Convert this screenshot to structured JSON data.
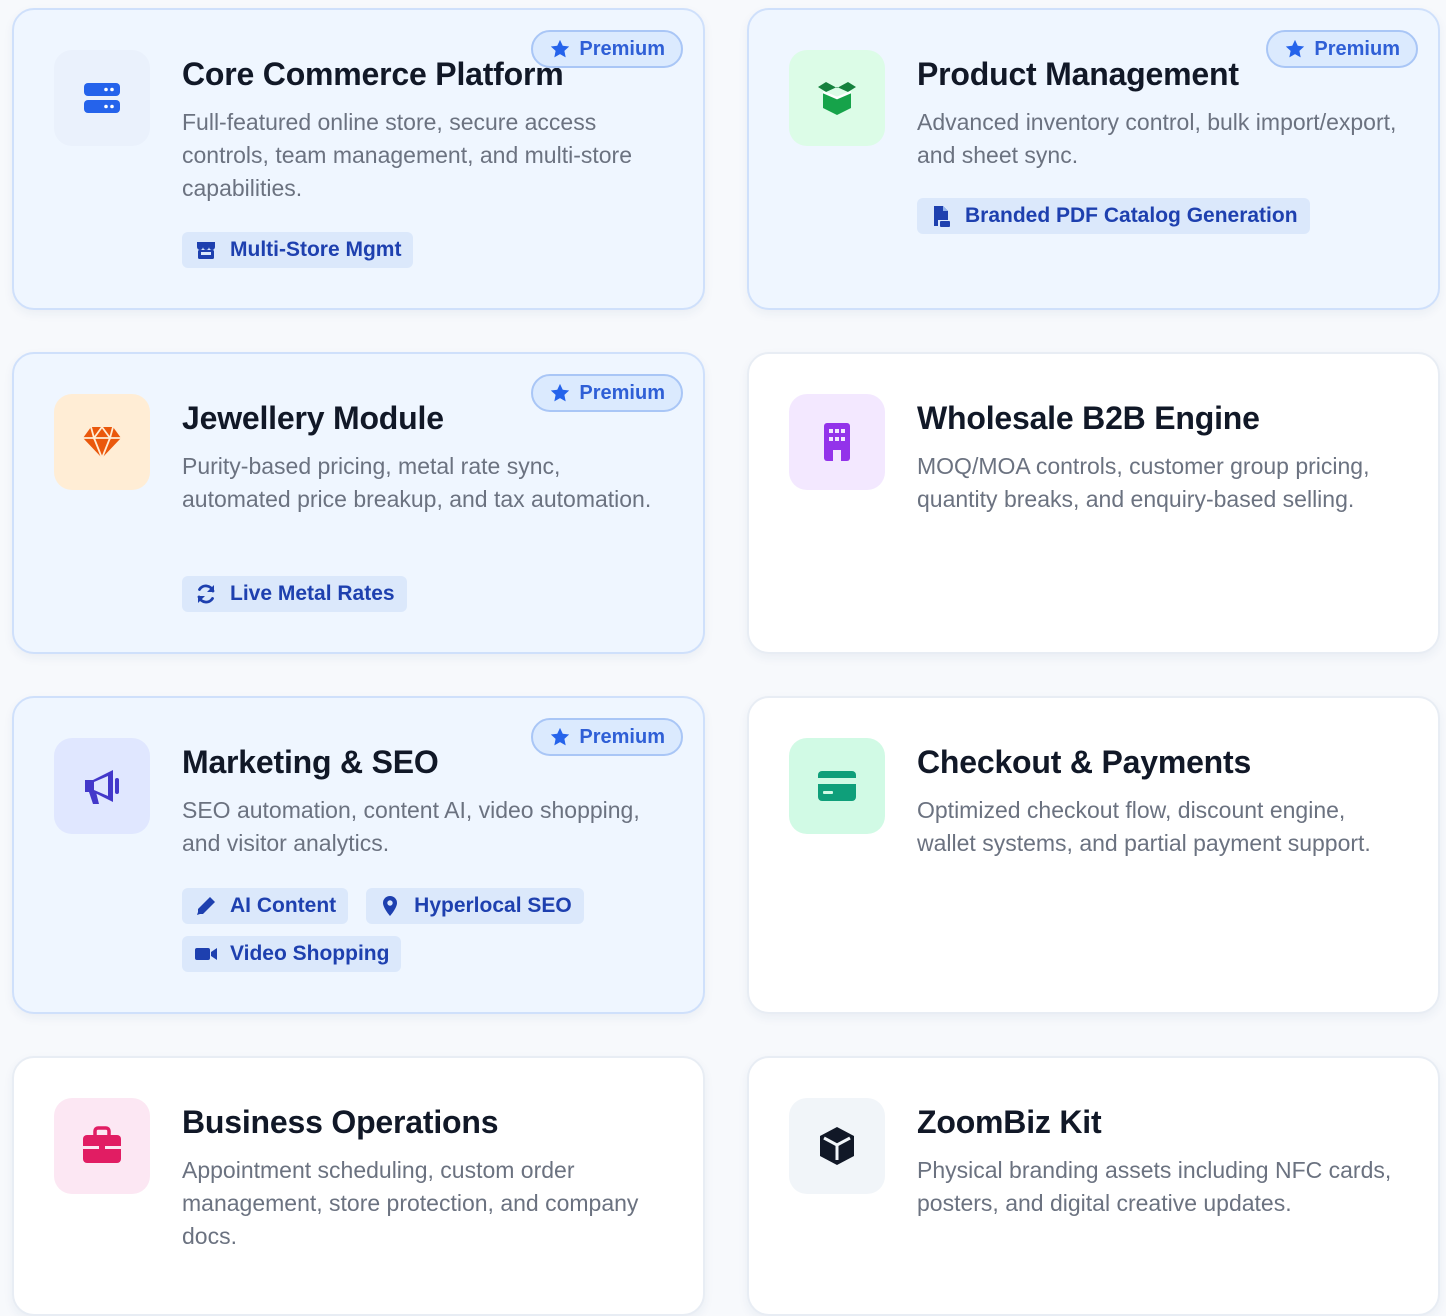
{
  "premium_label": "Premium",
  "colors": {
    "premium_card_bg": "#eff6ff",
    "badge_bg": "#dbeafe",
    "badge_text": "#2f5fd6",
    "tag_bg": "#dbe8fb",
    "tag_text": "#1e40af"
  },
  "cards": [
    {
      "title": "Core Commerce Platform",
      "description": "Full-featured online store, secure access controls, team management, and multi-store capabilities.",
      "icon": "server-icon",
      "premium": true,
      "tags": [
        {
          "label": "Multi-Store Mgmt",
          "icon": "store-icon"
        }
      ]
    },
    {
      "title": "Product Management",
      "description": "Advanced inventory control, bulk import/export, and sheet sync.",
      "icon": "box-open-icon",
      "premium": true,
      "tags": [
        {
          "label": "Branded PDF Catalog Generation",
          "icon": "file-pdf-icon"
        }
      ]
    },
    {
      "title": "Jewellery Module",
      "description": "Purity-based pricing, metal rate sync, automated price breakup, and tax automation.",
      "icon": "gem-icon",
      "premium": true,
      "tags": [
        {
          "label": "Live Metal Rates",
          "icon": "sync-icon"
        }
      ]
    },
    {
      "title": "Wholesale B2B Engine",
      "description": "MOQ/MOA controls, customer group pricing, quantity breaks, and enquiry-based selling.",
      "icon": "building-icon",
      "premium": false,
      "tags": []
    },
    {
      "title": "Marketing & SEO",
      "description": "SEO automation, content AI, video shopping, and visitor analytics.",
      "icon": "megaphone-icon",
      "premium": true,
      "tags": [
        {
          "label": "AI Content",
          "icon": "pen-icon"
        },
        {
          "label": "Hyperlocal SEO",
          "icon": "map-pin-icon"
        },
        {
          "label": "Video Shopping",
          "icon": "video-icon"
        }
      ]
    },
    {
      "title": "Checkout & Payments",
      "description": "Optimized checkout flow, discount engine, wallet systems, and partial payment support.",
      "icon": "credit-card-icon",
      "premium": false,
      "tags": []
    },
    {
      "title": "Business Operations",
      "description": "Appointment scheduling, custom order management, store protection, and company docs.",
      "icon": "briefcase-icon",
      "premium": false,
      "tags": []
    },
    {
      "title": "ZoomBiz Kit",
      "description": "Physical branding assets including NFC cards, posters, and digital creative updates.",
      "icon": "cube-icon",
      "premium": false,
      "tags": []
    }
  ]
}
